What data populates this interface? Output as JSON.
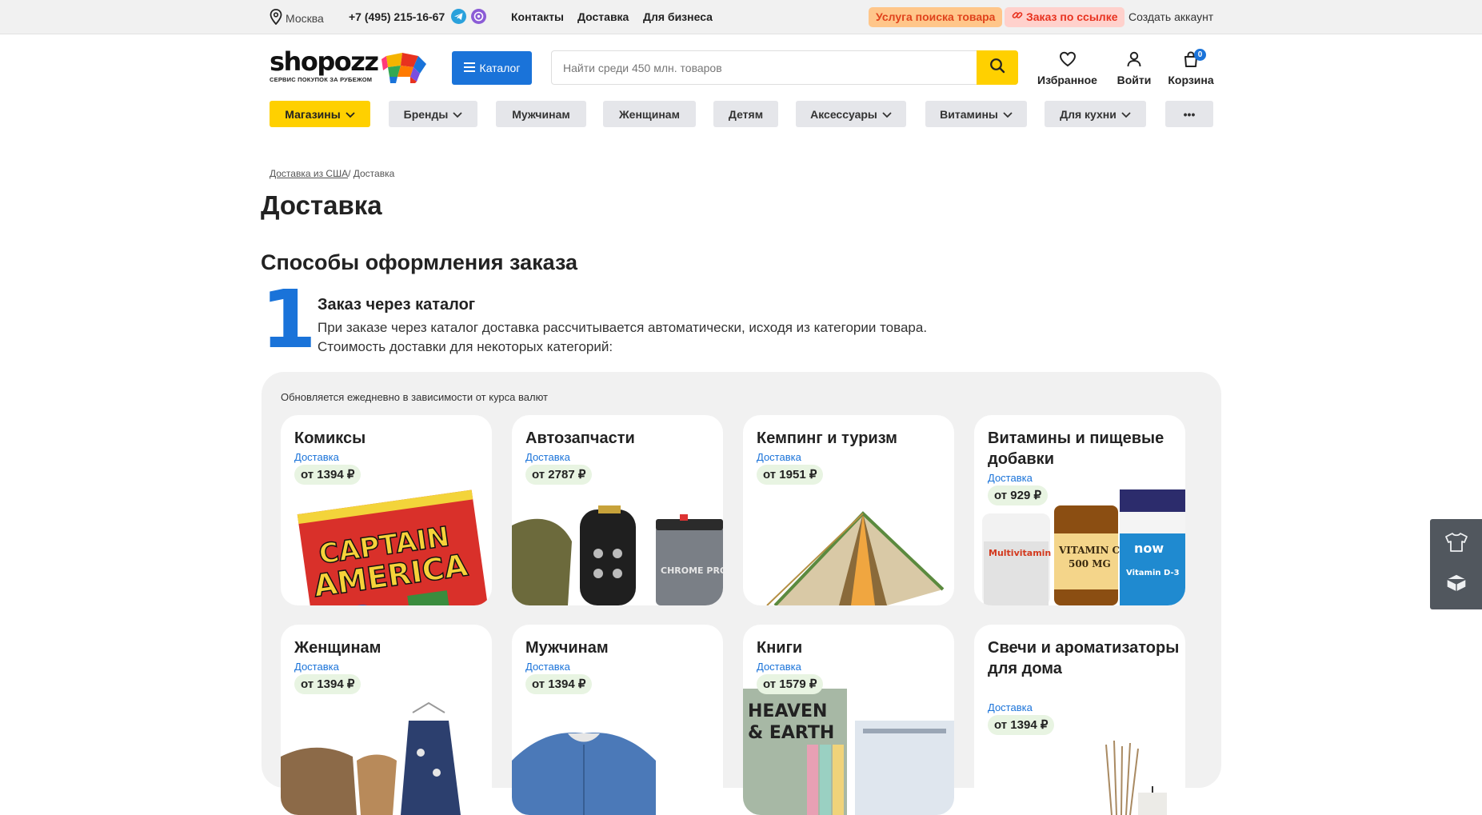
{
  "topbar": {
    "city": "Москва",
    "phone": "+7 (495) 215-16-67",
    "links": [
      "Контакты",
      "Доставка",
      "Для бизнеса"
    ],
    "service_search": "Услуга поиска товара",
    "order_by_link": "Заказ по ссылке",
    "create_account": "Создать аккаунт"
  },
  "header": {
    "logo": "shopozz",
    "logo_tagline": "СЕРВИС ПОКУПОК ЗА РУБЕЖОМ",
    "catalog_label": "Каталог",
    "search_placeholder": "Найти среди 450 млн. товаров",
    "favorites": "Избранное",
    "login": "Войти",
    "cart": "Корзина",
    "cart_count": "0"
  },
  "categories": [
    "Магазины",
    "Бренды",
    "Мужчинам",
    "Женщинам",
    "Детям",
    "Аксессуары",
    "Витамины",
    "Для кухни",
    "•••"
  ],
  "breadcrumb": {
    "parent": "Доставка из США",
    "current": "/ Доставка"
  },
  "page": {
    "title": "Доставка",
    "section_title": "Способы оформления заказа",
    "step_number": "1",
    "step_title": "Заказ через каталог",
    "step_desc_1": "При заказе через каталог доставка рассчитывается автоматически, исходя из категории товара.",
    "step_desc_2": "Стоимость доставки для некоторых категорий:",
    "panel_note": "Обновляется ежедневно в зависимости от курса валют"
  },
  "cards": [
    {
      "title": "Комиксы",
      "sub": "Доставка",
      "price": "от 1394 ₽",
      "art": "comic"
    },
    {
      "title": "Автозапчасти",
      "sub": "Доставка",
      "price": "от 2787 ₽",
      "art": "auto"
    },
    {
      "title": "Кемпинг и туризм",
      "sub": "Доставка",
      "price": "от 1951 ₽",
      "art": "tent"
    },
    {
      "title": "Витамины и пищевые добавки",
      "sub": "Доставка",
      "price": "от 929 ₽",
      "art": "vitamins"
    },
    {
      "title": "Женщинам",
      "sub": "Доставка",
      "price": "от 1394 ₽",
      "art": "women"
    },
    {
      "title": "Мужчинам",
      "sub": "Доставка",
      "price": "от 1394 ₽",
      "art": "men"
    },
    {
      "title": "Книги",
      "sub": "Доставка",
      "price": "от 1579 ₽",
      "art": "books"
    },
    {
      "title": "Свечи и ароматизаторы для дома",
      "sub": "Доставка",
      "price": "от 1394 ₽",
      "art": "candles"
    }
  ],
  "art_text": {
    "comic_1": "CAPTAIN",
    "comic_2": "AMERICA",
    "auto_brand": "CHROME PRO",
    "vit_1": "Multivitamin",
    "vit_2": "VITAMIN C",
    "vit_2b": "500 MG",
    "vit_3": "now",
    "vit_3b": "Vitamin D-3",
    "books_1": "HEAVEN",
    "books_2": "& EARTH"
  }
}
